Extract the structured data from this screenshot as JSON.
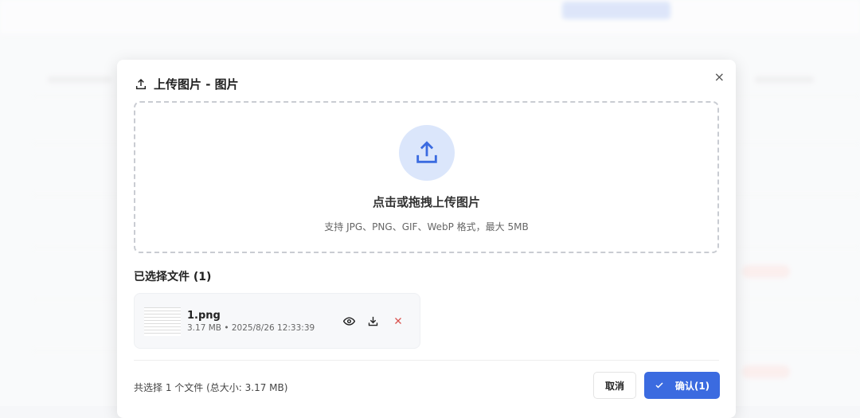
{
  "modal": {
    "title": "上传图片 - 图片",
    "close": "×",
    "dropzone": {
      "title": "点击或拖拽上传图片",
      "subtitle": "支持 JPG、PNG、GIF、WebP 格式，最大 5MB"
    },
    "selected_heading": "已选择文件 (1)",
    "files": [
      {
        "name": "1.png",
        "meta": "3.17 MB • 2025/8/26 12:33:39"
      }
    ],
    "summary": "共选择 1 个文件 (总大小: 3.17 MB)",
    "cancel": "取消",
    "confirm": "确认(1)"
  },
  "colors": {
    "primary": "#3b6be0",
    "danger": "#d9534f"
  }
}
